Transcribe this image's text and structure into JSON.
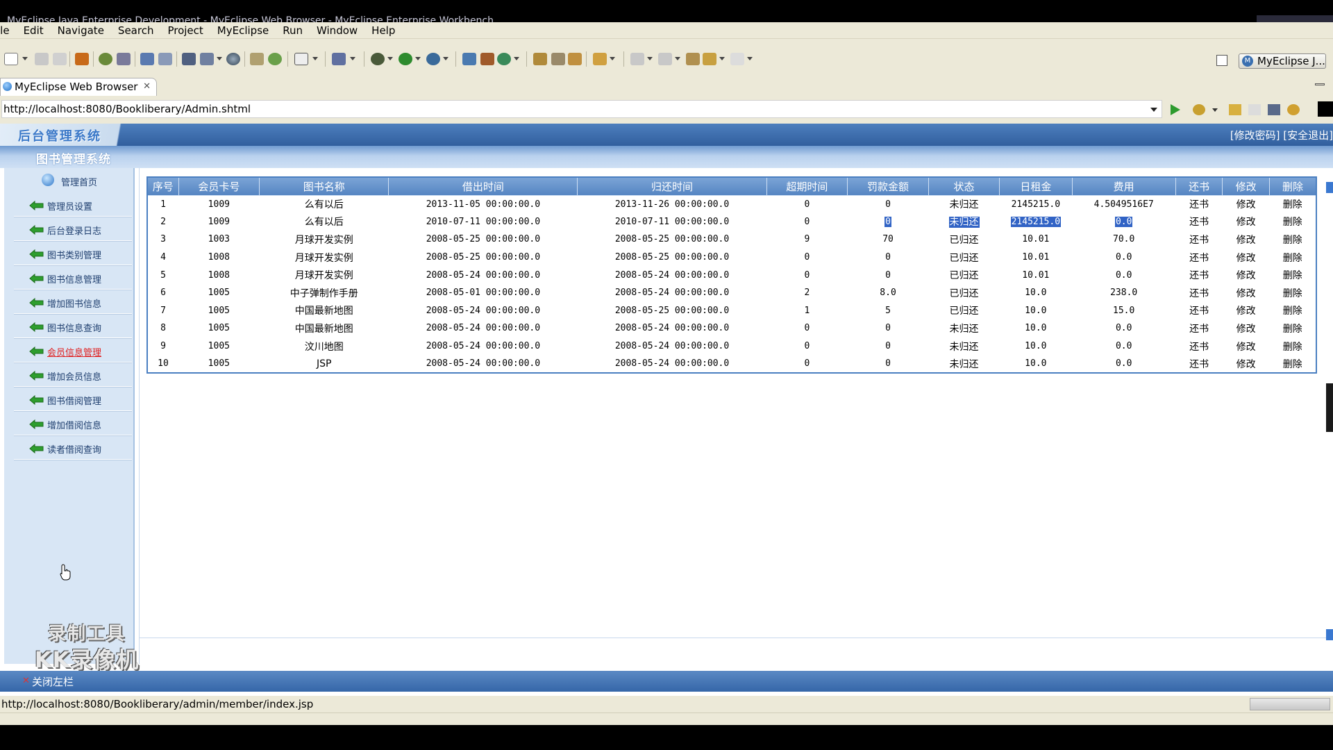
{
  "window": {
    "title": "MyEclipse Java Enterprise Development - MyEclipse Web Browser - MyEclipse Enterprise Workbench"
  },
  "menu": [
    "ile",
    "Edit",
    "Navigate",
    "Search",
    "Project",
    "MyEclipse",
    "Run",
    "Window",
    "Help"
  ],
  "perspective": {
    "label": "MyEclipse J..."
  },
  "tab": {
    "label": "MyEclipse Web Browser",
    "close": "✕"
  },
  "browser": {
    "url": "http://localhost:8080/Bookliberary/Admin.shtml"
  },
  "page": {
    "logo": "后台管理系统",
    "header_links": "[修改密码] [安全退出]",
    "subtitle": "图书管理系统",
    "sidebar": {
      "home": "管理首页",
      "items": [
        "管理员设置",
        "后台登录日志",
        "图书类别管理",
        "图书信息管理",
        "增加图书信息",
        "图书信息查询",
        "会员信息管理",
        "增加会员信息",
        "图书借阅管理",
        "增加借阅信息",
        "读者借阅查询"
      ],
      "active_index": 6
    },
    "table": {
      "columns": [
        "序号",
        "会员卡号",
        "图书名称",
        "借出时间",
        "归还时间",
        "超期时间",
        "罚款金额",
        "状态",
        "日租金",
        "费用",
        "还书",
        "修改",
        "删除"
      ],
      "rows": [
        [
          "1",
          "1009",
          "么有以后",
          "2013-11-05 00:00:00.0",
          "2013-11-26 00:00:00.0",
          "0",
          "0",
          "未归还",
          "2145215.0",
          "4.5049516E7",
          "还书",
          "修改",
          "删除"
        ],
        [
          "2",
          "1009",
          "么有以后",
          "2010-07-11 00:00:00.0",
          "2010-07-11 00:00:00.0",
          "0",
          "0",
          "未归还",
          "2145215.0",
          "0.0",
          "还书",
          "修改",
          "删除"
        ],
        [
          "3",
          "1003",
          "月球开发实例",
          "2008-05-25 00:00:00.0",
          "2008-05-25 00:00:00.0",
          "9",
          "70",
          "已归还",
          "10.01",
          "70.0",
          "还书",
          "修改",
          "删除"
        ],
        [
          "4",
          "1008",
          "月球开发实例",
          "2008-05-25 00:00:00.0",
          "2008-05-25 00:00:00.0",
          "0",
          "0",
          "已归还",
          "10.01",
          "0.0",
          "还书",
          "修改",
          "删除"
        ],
        [
          "5",
          "1008",
          "月球开发实例",
          "2008-05-24 00:00:00.0",
          "2008-05-24 00:00:00.0",
          "0",
          "0",
          "已归还",
          "10.01",
          "0.0",
          "还书",
          "修改",
          "删除"
        ],
        [
          "6",
          "1005",
          "中子弹制作手册",
          "2008-05-01 00:00:00.0",
          "2008-05-24 00:00:00.0",
          "2",
          "8.0",
          "已归还",
          "10.0",
          "238.0",
          "还书",
          "修改",
          "删除"
        ],
        [
          "7",
          "1005",
          "中国最新地图",
          "2008-05-24 00:00:00.0",
          "2008-05-25 00:00:00.0",
          "1",
          "5",
          "已归还",
          "10.0",
          "15.0",
          "还书",
          "修改",
          "删除"
        ],
        [
          "8",
          "1005",
          "中国最新地图",
          "2008-05-24 00:00:00.0",
          "2008-05-24 00:00:00.0",
          "0",
          "0",
          "未归还",
          "10.0",
          "0.0",
          "还书",
          "修改",
          "删除"
        ],
        [
          "9",
          "1005",
          "汶川地图",
          "2008-05-24 00:00:00.0",
          "2008-05-24 00:00:00.0",
          "0",
          "0",
          "未归还",
          "10.0",
          "0.0",
          "还书",
          "修改",
          "删除"
        ],
        [
          "10",
          "1005",
          "JSP",
          "2008-05-24 00:00:00.0",
          "2008-05-24 00:00:00.0",
          "0",
          "0",
          "未归还",
          "10.0",
          "0.0",
          "还书",
          "修改",
          "删除"
        ]
      ],
      "selection": {
        "row": 1,
        "cols": [
          6,
          7,
          8,
          9
        ]
      }
    },
    "footer": {
      "close_left": "关闭左栏"
    }
  },
  "watermark": {
    "line1": "录制工具",
    "line2": "KK录像机"
  },
  "status": {
    "text": "http://localhost:8080/Bookliberary/admin/member/index.jsp"
  },
  "colors": {
    "header_blue": "#315f9e",
    "table_border": "#4a7fc1",
    "selection": "#3163c5",
    "active_link": "#e02020"
  }
}
